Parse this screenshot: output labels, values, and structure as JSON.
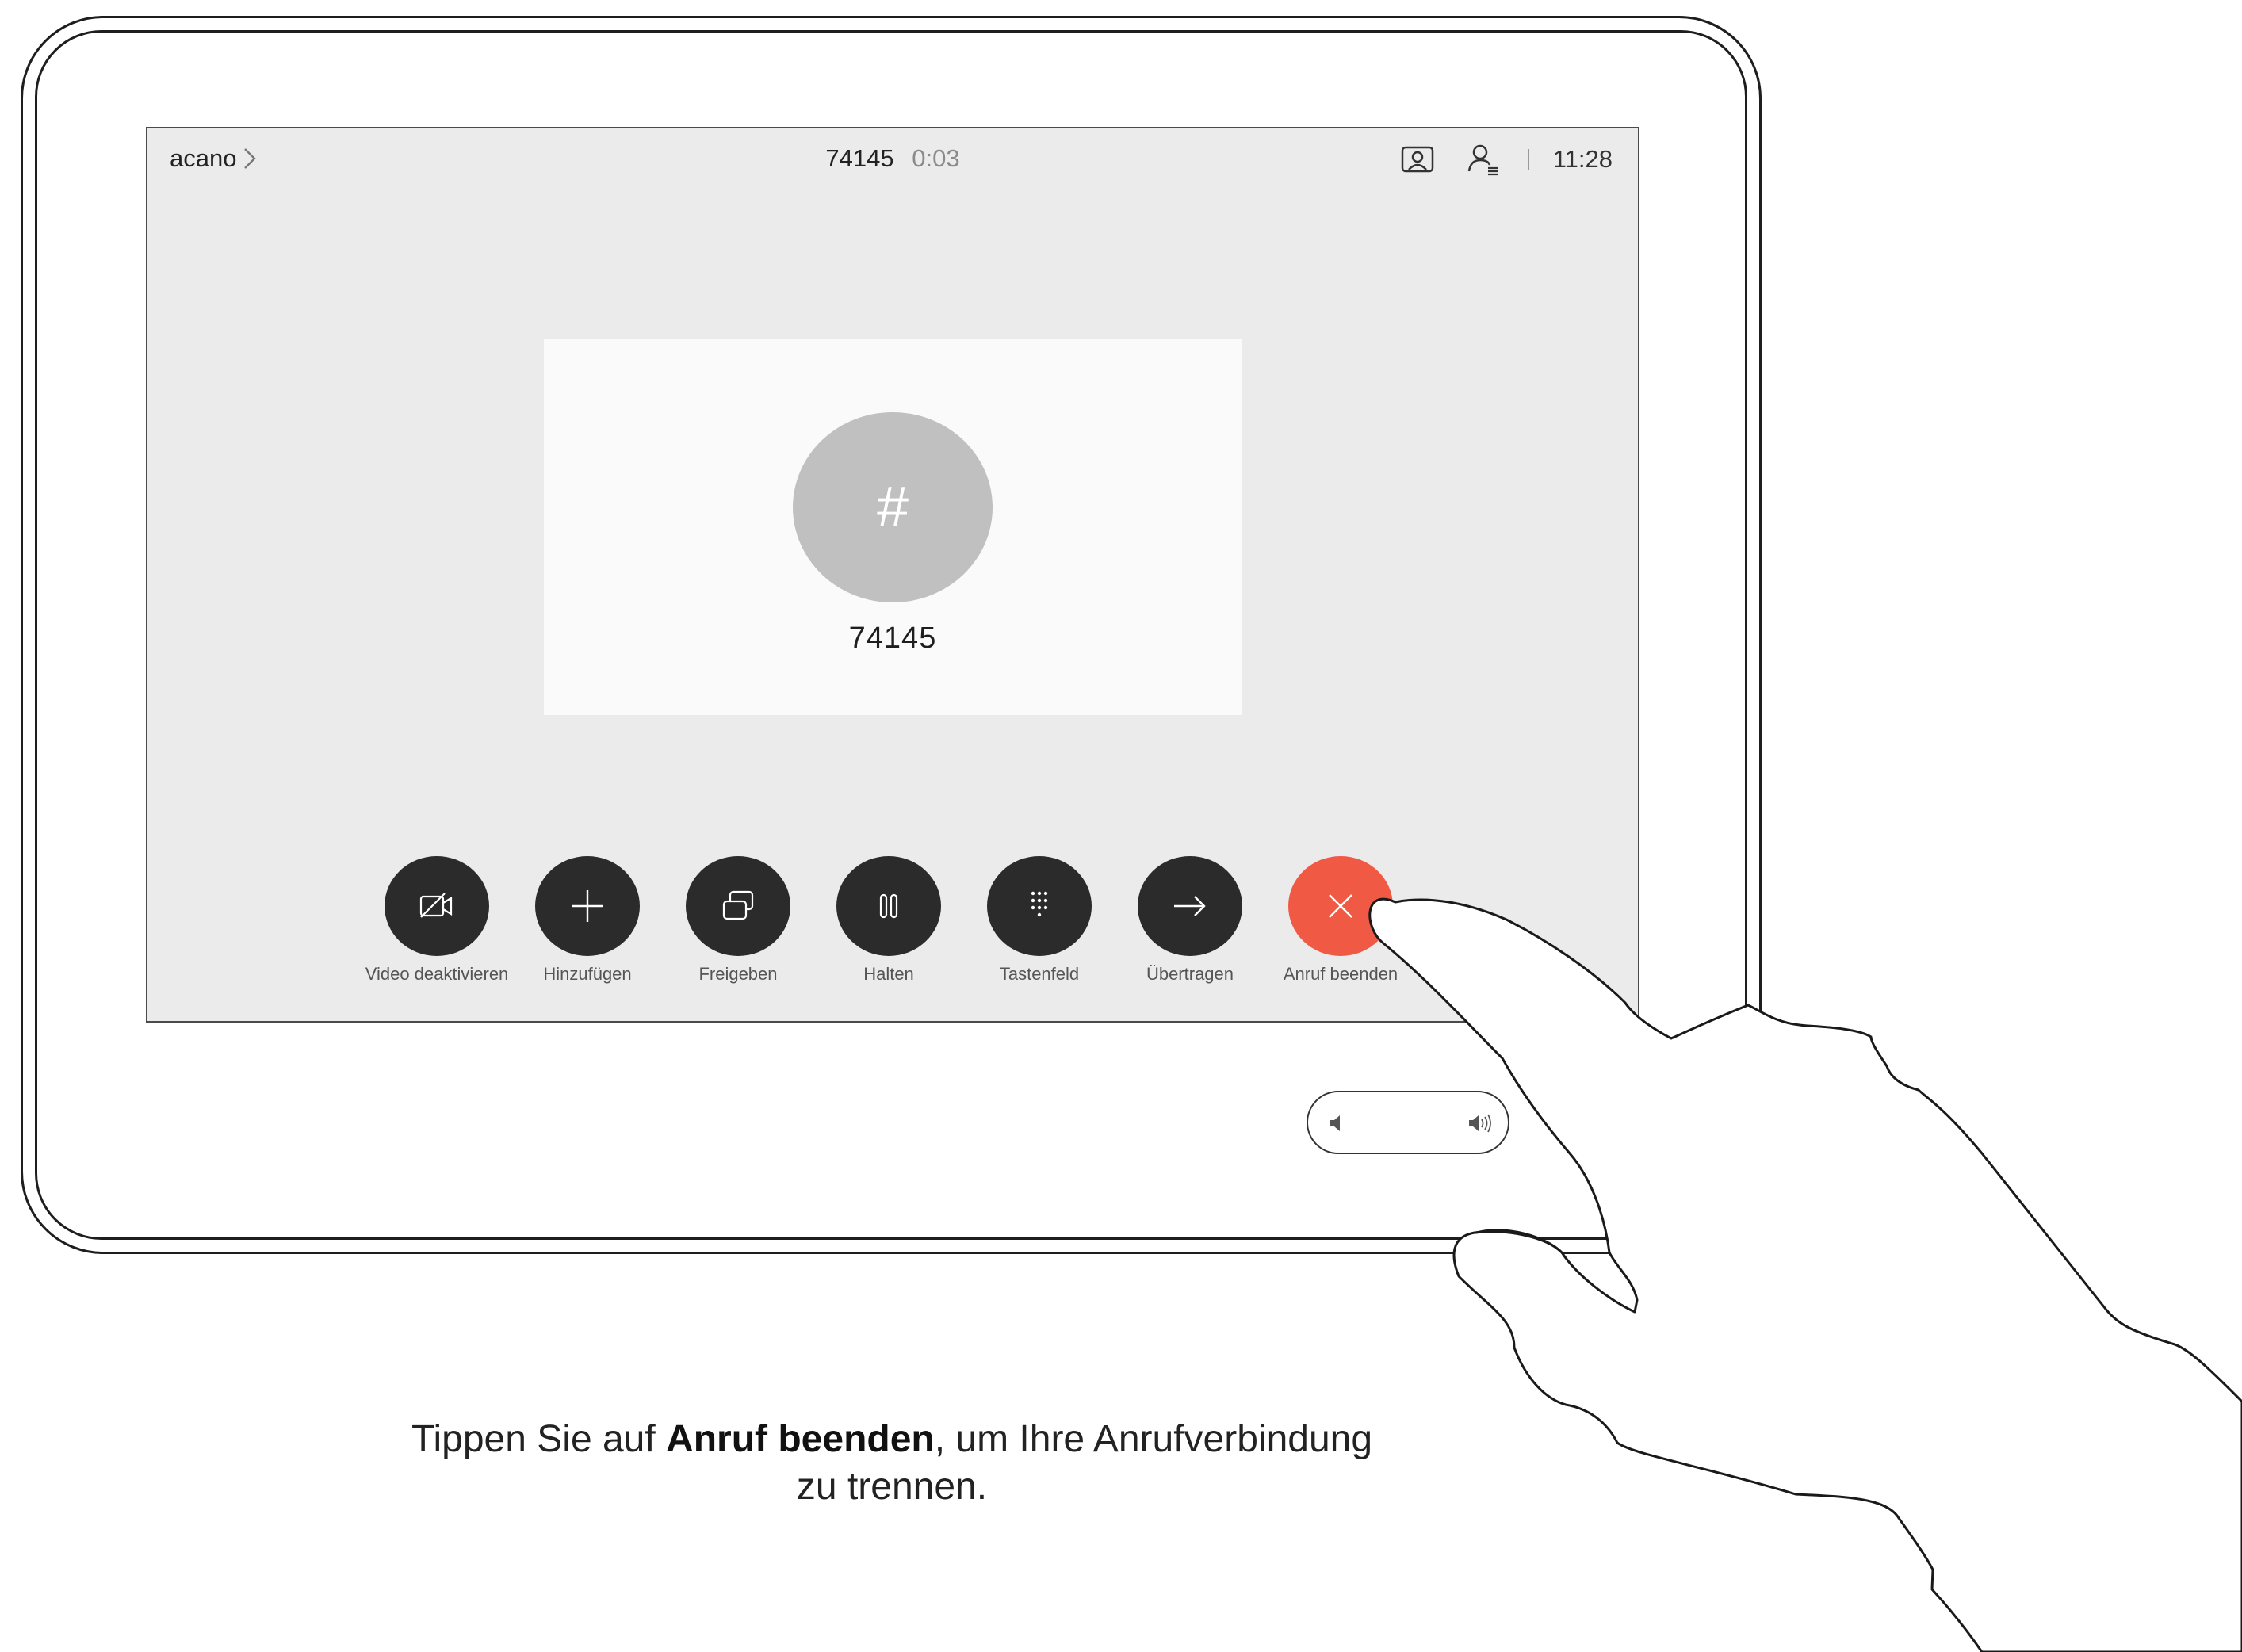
{
  "topbar": {
    "system_name": "acano",
    "call_number": "74145",
    "call_duration": "0:03",
    "clock": "11:28",
    "icons": [
      "selfview-icon",
      "participants-icon",
      "chevron-right-icon"
    ]
  },
  "call_card": {
    "avatar_symbol": "#",
    "number": "74145"
  },
  "controls": {
    "video": "Video deaktivieren",
    "add": "Hinzufügen",
    "share": "Freigeben",
    "hold": "Halten",
    "keypad": "Tastenfeld",
    "transfer": "Übertragen",
    "end_call": "Anruf beenden"
  },
  "volume": {
    "icons": [
      "volume-down-icon",
      "volume-up-icon"
    ]
  },
  "caption": {
    "prefix": "Tippen Sie auf ",
    "emphasis": "Anruf beenden",
    "suffix": ", um Ihre Anrufverbindung",
    "line2": "zu trennen."
  },
  "colors": {
    "screen_bg": "#ebebeb",
    "button_dark": "#2b2b2b",
    "end_call_red": "#f05a45",
    "avatar_gray": "#c0c0c0"
  }
}
